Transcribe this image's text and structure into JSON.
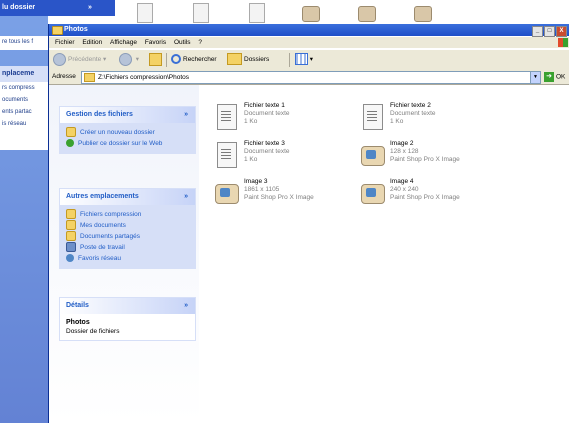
{
  "background_window": {
    "title": "lu dossier",
    "item1": "re tous les f",
    "section": "nplaceme",
    "items": [
      "rs compress",
      "ocuments",
      "ents partac",
      "is réseau"
    ]
  },
  "window": {
    "title": "Photos",
    "controls": [
      "_",
      "□",
      "X"
    ]
  },
  "menu": [
    "Fichier",
    "Edition",
    "Affichage",
    "Favoris",
    "Outils",
    "?"
  ],
  "toolbar": {
    "back": "Précédente",
    "search": "Rechercher",
    "folders": "Dossiers"
  },
  "address": {
    "label": "Adresse",
    "value": "Z:\\Fichiers compression\\Photos",
    "go": "OK"
  },
  "panels": {
    "tasks": {
      "title": "Gestion des fichiers",
      "items": [
        "Créer un nouveau dossier",
        "Publier ce dossier sur le Web"
      ]
    },
    "places": {
      "title": "Autres emplacements",
      "items": [
        "Fichiers compression",
        "Mes documents",
        "Documents partagés",
        "Poste de travail",
        "Favoris réseau"
      ]
    },
    "details": {
      "title": "Détails",
      "name": "Photos",
      "type": "Dossier de fichiers"
    },
    "chevron": "»"
  },
  "files": [
    {
      "name": "Fichier texte 1",
      "line1": "Document texte",
      "line2": "1 Ko",
      "icon": "text-file-icon"
    },
    {
      "name": "Fichier texte 2",
      "line1": "Document texte",
      "line2": "1 Ko",
      "icon": "text-file-icon"
    },
    {
      "name": "Fichier texte 3",
      "line1": "Document texte",
      "line2": "1 Ko",
      "icon": "text-file-icon"
    },
    {
      "name": "Image 2",
      "line1": "128 x 128",
      "line2": "Paint Shop Pro X Image",
      "icon": "image-file-icon"
    },
    {
      "name": "Image 3",
      "line1": "1861 x 1105",
      "line2": "Paint Shop Pro X Image",
      "icon": "image-file-icon"
    },
    {
      "name": "Image 4",
      "line1": "240 x 240",
      "line2": "Paint Shop Pro X Image",
      "icon": "image-file-icon"
    }
  ],
  "colors": {
    "title_blue": "#1f4fc8",
    "link_blue": "#215dc6",
    "panel_bg": "#d6dff7",
    "chrome": "#ece9d8"
  }
}
